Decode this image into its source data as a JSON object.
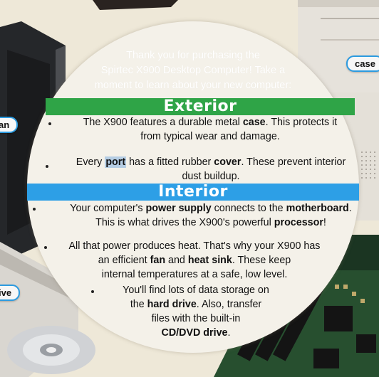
{
  "callouts": {
    "left_top": "an",
    "right": "case",
    "left_bottom": "ive"
  },
  "intro": {
    "line1": "Thank you for purchasing the",
    "line2": "Spirtec X900 Desktop Computer! Take a",
    "line3": "moment to learn about your new computer:"
  },
  "exterior": {
    "heading": "Exterior",
    "b1_a": "The X900 features a durable metal ",
    "b1_b": "case",
    "b1_c": ". This protects it",
    "b1_d": "from typical wear and damage.",
    "b2_a": "Every ",
    "b2_b": "port",
    "b2_c": " has a fitted rubber ",
    "b2_d": "cover",
    "b2_e": ". These prevent interior",
    "b2_f": "dust buildup."
  },
  "interior": {
    "heading": "Interior",
    "b1_a": "Your computer's ",
    "b1_b": "power supply",
    "b1_c": " connects to the ",
    "b1_d": "motherboard",
    "b1_e": ".",
    "b1_f": "This is what drives the X900's powerful ",
    "b1_g": "processor",
    "b1_h": "!",
    "b2_a": "All that power produces heat. That's why your X900 has",
    "b2_b": "an efficient ",
    "b2_c": "fan",
    "b2_d": " and ",
    "b2_e": "heat sink",
    "b2_f": ". These keep",
    "b2_g": "internal temperatures at a safe, low level.",
    "b3_a": "You'll find lots of data storage on",
    "b3_b": "the ",
    "b3_c": "hard drive",
    "b3_d": ". Also, transfer",
    "b3_e": "files with the built-in",
    "b3_f": "CD/DVD drive",
    "b3_g": "."
  }
}
